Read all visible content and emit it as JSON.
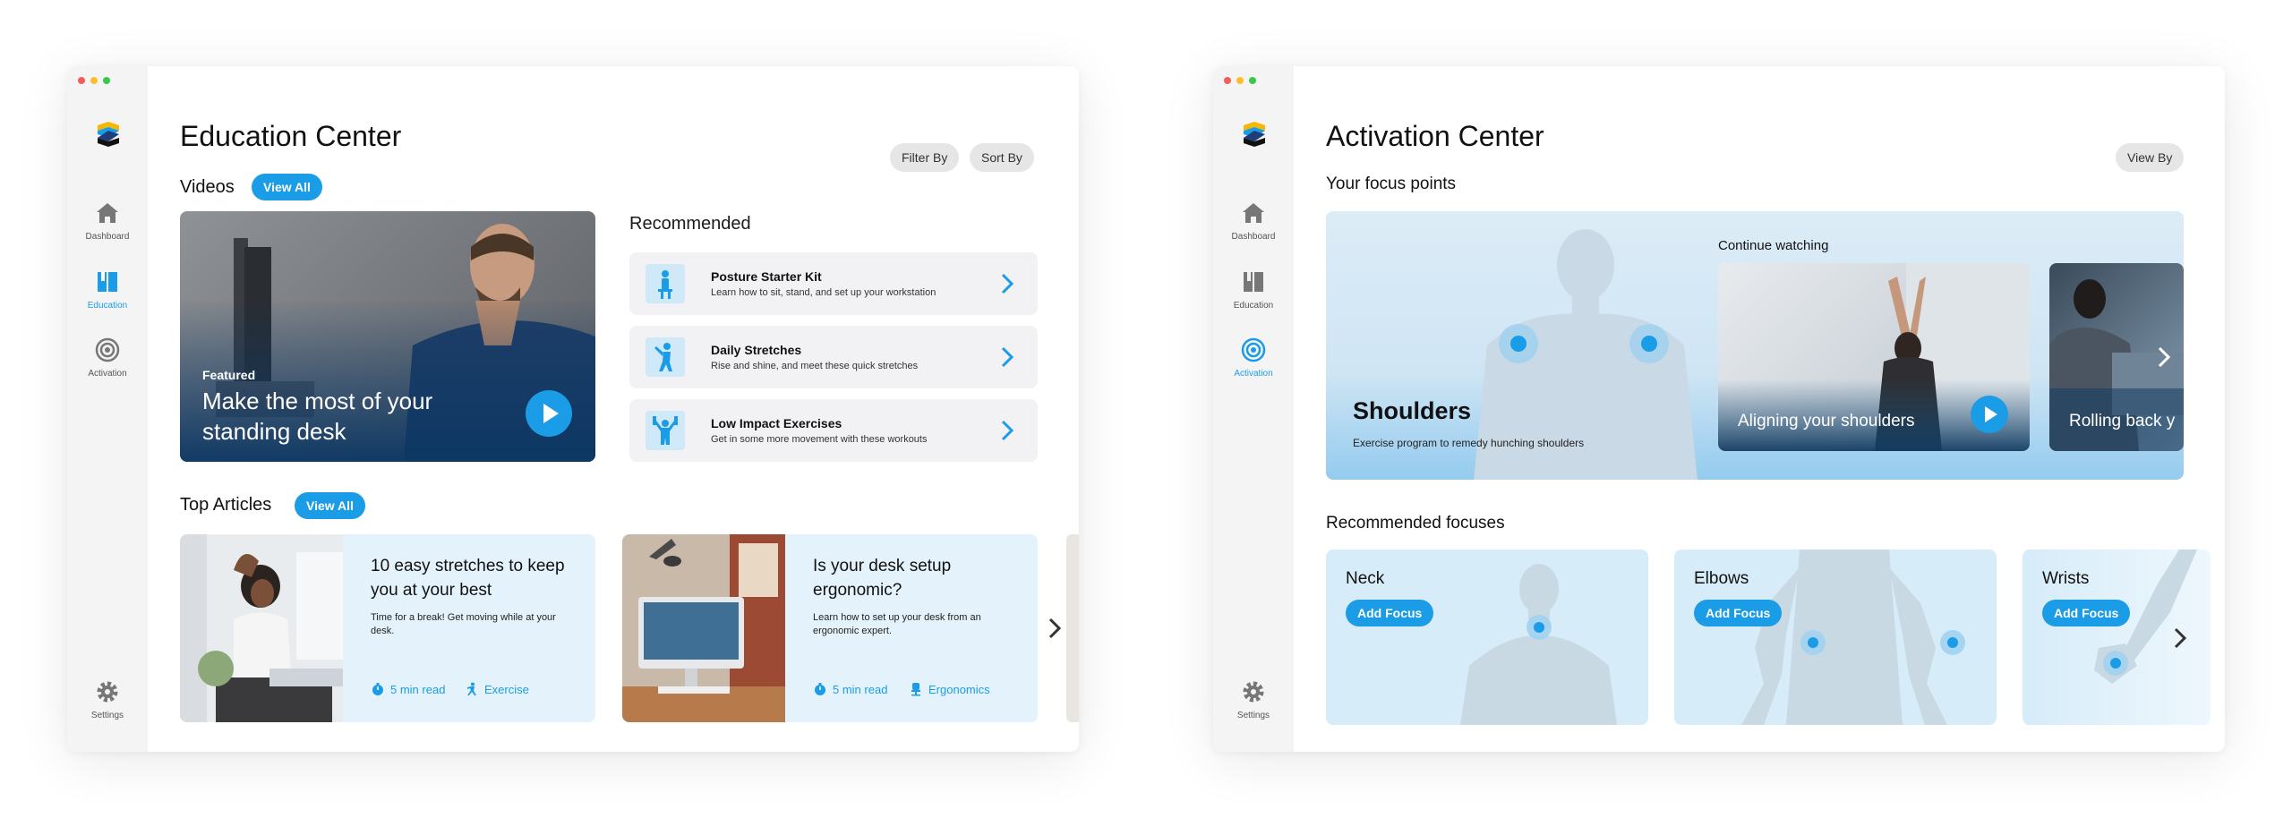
{
  "education": {
    "sidebar": {
      "items": [
        {
          "label": "Dashboard",
          "icon": "home-icon"
        },
        {
          "label": "Education",
          "icon": "book-icon",
          "active": true
        },
        {
          "label": "Activation",
          "icon": "target-icon"
        }
      ],
      "settings_label": "Settings"
    },
    "title": "Education Center",
    "filter_label": "Filter By",
    "sort_label": "Sort By",
    "videos": {
      "heading": "Videos",
      "view_all": "View All",
      "featured_eyebrow": "Featured",
      "featured_title": "Make the most of your standing desk"
    },
    "recommended": {
      "heading": "Recommended",
      "items": [
        {
          "title": "Posture Starter Kit",
          "desc": "Learn how to sit, stand, and set up your workstation",
          "icon": "posture-icon"
        },
        {
          "title": "Daily Stretches",
          "desc": "Rise and shine, and meet these quick stretches",
          "icon": "stretch-icon"
        },
        {
          "title": "Low Impact Exercises",
          "desc": "Get in some more movement with these workouts",
          "icon": "exercise-icon"
        }
      ]
    },
    "articles": {
      "heading": "Top Articles",
      "view_all": "View All",
      "items": [
        {
          "title": "10 easy stretches to keep you at your best",
          "desc": "Time for a break! Get moving while at your desk.",
          "read": "5 min read",
          "tag": "Exercise"
        },
        {
          "title": "Is your desk setup ergonomic?",
          "desc": "Learn how to set up your desk from an ergonomic expert.",
          "read": "5 min read",
          "tag": "Ergonomics"
        }
      ]
    }
  },
  "activation": {
    "sidebar": {
      "items": [
        {
          "label": "Dashboard",
          "icon": "home-icon"
        },
        {
          "label": "Education",
          "icon": "book-icon"
        },
        {
          "label": "Activation",
          "icon": "target-icon",
          "active": true
        }
      ],
      "settings_label": "Settings"
    },
    "title": "Activation Center",
    "view_by_label": "View By",
    "focus_heading": "Your focus points",
    "hero": {
      "name": "Shoulders",
      "desc": "Exercise program to remedy hunching shoulders",
      "continue_label": "Continue watching",
      "videos": [
        {
          "title": "Aligning your shoulders"
        },
        {
          "title": "Rolling back y"
        }
      ]
    },
    "recommended_heading": "Recommended focuses",
    "focuses": [
      {
        "name": "Neck",
        "button": "Add Focus"
      },
      {
        "name": "Elbows",
        "button": "Add Focus"
      },
      {
        "name": "Wrists",
        "button": "Add Focus"
      }
    ]
  },
  "colors": {
    "accent": "#1b9ce6",
    "sidebar_bg": "#f4f4f5",
    "card_bg": "#e4f3fb",
    "traffic_red": "#f25f58",
    "traffic_yellow": "#fbbe2e",
    "traffic_green": "#39c84a"
  }
}
